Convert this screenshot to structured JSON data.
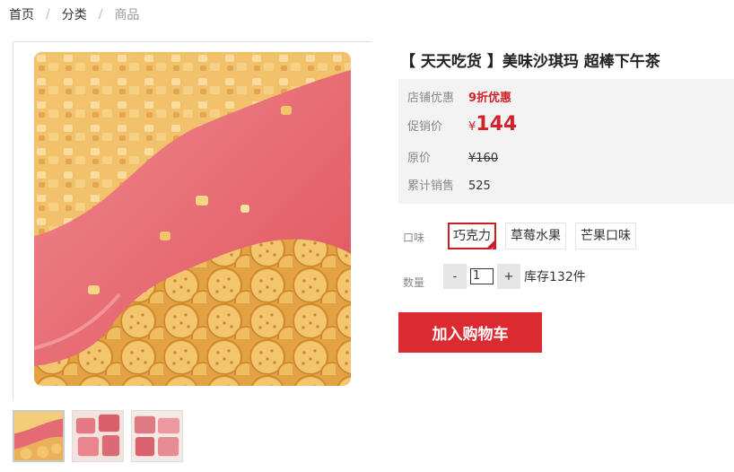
{
  "breadcrumb": {
    "home": "首页",
    "category": "分类",
    "current": "商品",
    "separator": "/"
  },
  "product": {
    "title": "【 天天吃货 】美味沙琪玛 超棒下午茶",
    "promo_label": "店铺优惠",
    "promo_value": "9折优惠",
    "price_label": "促销价",
    "currency": "¥",
    "price": "144",
    "original_label": "原价",
    "original_price": "¥160",
    "sales_label": "累计销售",
    "sales": "525"
  },
  "options": {
    "flavor_label": "口味",
    "flavors": [
      "巧克力",
      "草莓水果",
      "芒果口味"
    ],
    "selected_flavor": "巧克力",
    "quantity_label": "数量",
    "minus": "-",
    "plus": "+",
    "quantity": "1",
    "stock": "库存132件"
  },
  "actions": {
    "add_to_cart": "加入购物车"
  },
  "gallery": {
    "thumbnail_count": 3,
    "active_thumbnail": 1
  },
  "colors": {
    "accent": "#dc2a31",
    "price": "#d2232a",
    "price_box_bg": "#f3f3f3"
  }
}
